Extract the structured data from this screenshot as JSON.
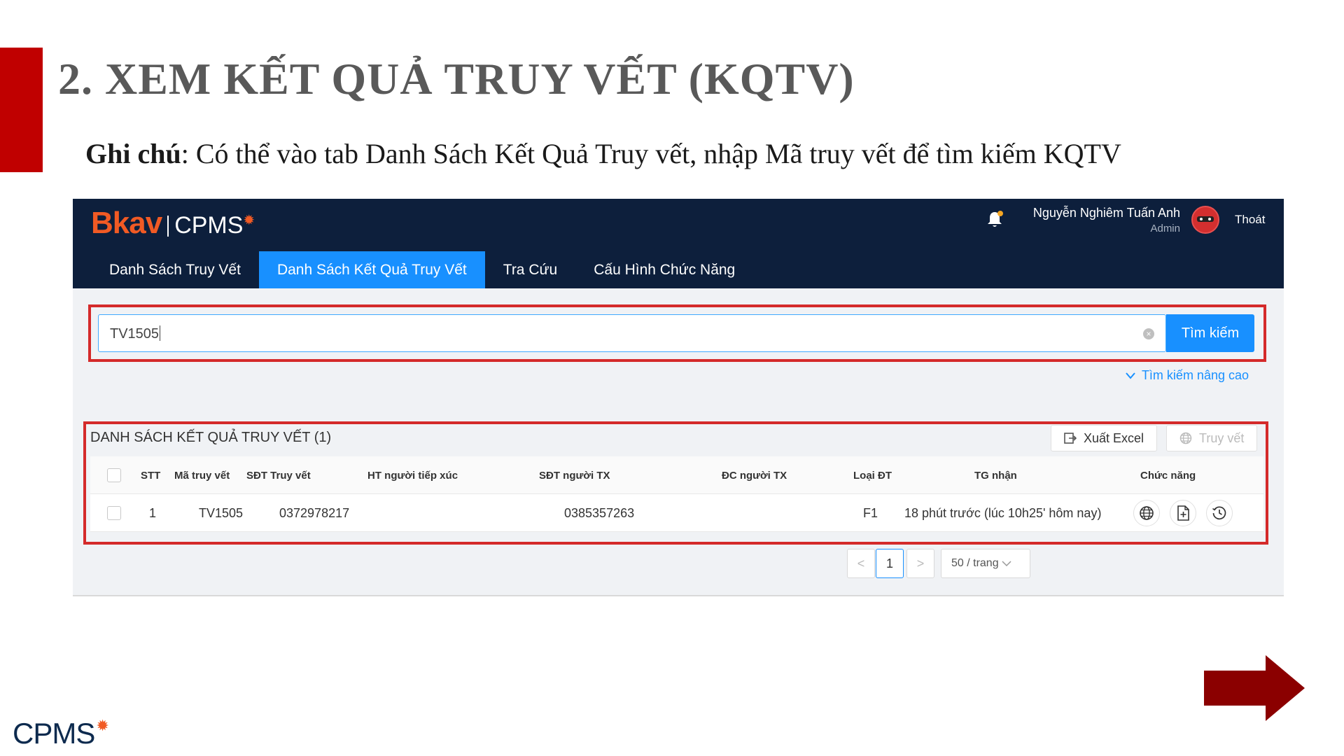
{
  "slide": {
    "title": "2. XEM KẾT QUẢ TRUY VẾT (KQTV)",
    "note_label": "Ghi chú",
    "note_text": ": Có thể vào tab Danh Sách Kết Quả Truy vết, nhập Mã truy vết để tìm kiếm KQTV",
    "accent_color": "#c00000"
  },
  "app": {
    "logo_brand": "Bkav",
    "logo_product": "CPMS",
    "user_name": "Nguyễn Nghiêm Tuấn Anh",
    "user_role": "Admin",
    "logout_label": "Thoát",
    "header_color": "#0d1f3c",
    "primary_color": "#1890ff",
    "nav_tabs": [
      {
        "label": "Danh Sách Truy Vết",
        "active": false
      },
      {
        "label": "Danh Sách Kết Quả Truy Vết",
        "active": true
      },
      {
        "label": "Tra Cứu",
        "active": false
      },
      {
        "label": "Cấu Hình Chức Năng",
        "active": false
      }
    ]
  },
  "search": {
    "value": "TV1505",
    "button_label": "Tìm kiếm",
    "advanced_label": "Tìm kiếm nâng cao"
  },
  "results": {
    "title": "DANH SÁCH KẾT QUẢ TRUY VẾT (1)",
    "export_label": "Xuất Excel",
    "trace_label": "Truy vết",
    "columns": [
      "STT",
      "Mã truy vết",
      "SĐT Truy vết",
      "HT người tiếp xúc",
      "SĐT người TX",
      "ĐC người TX",
      "Loại ĐT",
      "TG nhận",
      "Chức năng"
    ],
    "rows": [
      {
        "stt": "1",
        "ma_truy_vet": "TV1505",
        "sdt_truy_vet": "0372978217",
        "ht_nguoi_tiep_xuc": "",
        "sdt_nguoi_tx": "0385357263",
        "dc_nguoi_tx": "",
        "loai_dt": "F1",
        "tg_nhan": "18 phút trước (lúc 10h25' hôm nay)"
      }
    ],
    "action_icons": [
      "globe-icon",
      "file-add-icon",
      "history-icon"
    ]
  },
  "pagination": {
    "prev_symbol": "<",
    "current_page": "1",
    "next_symbol": ">",
    "page_size_label": "50 / trang"
  },
  "footer": {
    "logo_text": "CPMS"
  }
}
